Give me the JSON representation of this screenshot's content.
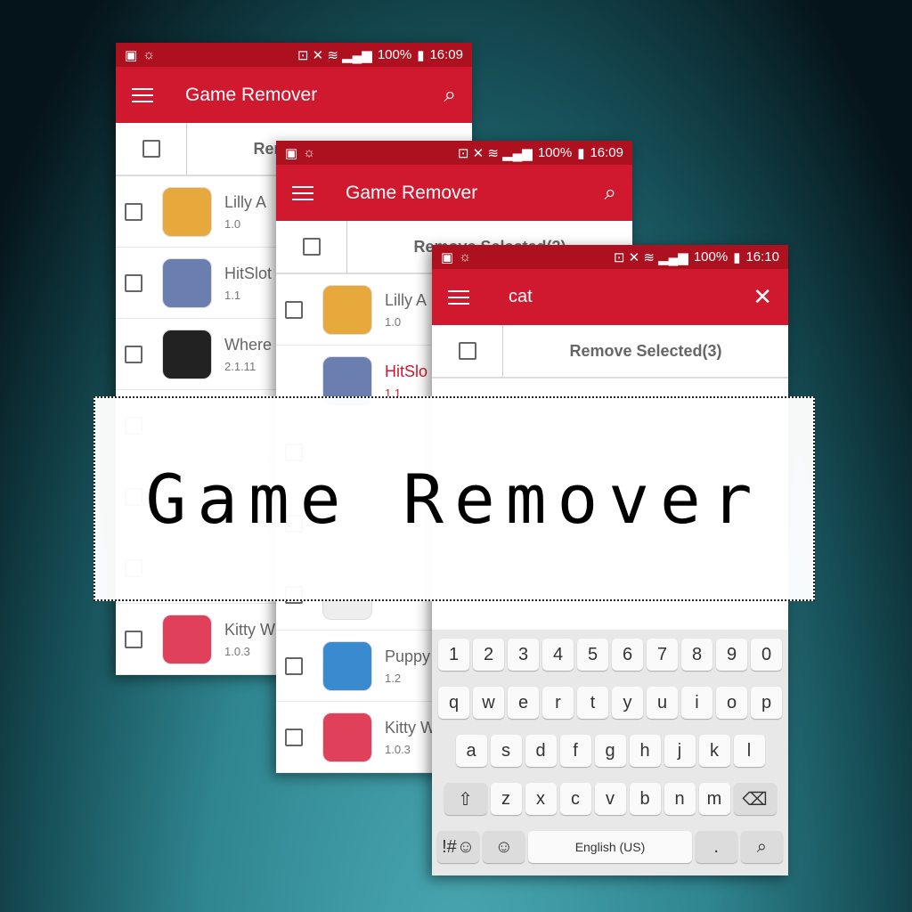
{
  "app_title": "Game Remover",
  "remove_selected": "Remove Selected(3)",
  "banner_text": "Game Remover",
  "phones": [
    {
      "status": {
        "battery": "100%",
        "time": "16:09"
      },
      "rows": [
        {
          "name": "Lilly A",
          "version": "1.0",
          "color": "#e8a93c"
        },
        {
          "name": "HitSlot",
          "version": "1.1",
          "color": "#6a7fb0"
        },
        {
          "name": "Where",
          "version": "2.1.11",
          "color": "#222222"
        },
        {
          "name": "",
          "version": "",
          "color": "#eeeeee"
        },
        {
          "name": "",
          "version": "",
          "color": "#eeeeee"
        },
        {
          "name": "",
          "version": "",
          "color": "#eeeeee"
        },
        {
          "name": "Kitty W",
          "version": "1.0.3",
          "color": "#e0405a"
        }
      ]
    },
    {
      "status": {
        "battery": "100%",
        "time": "16:09"
      },
      "rows": [
        {
          "name": "Lilly A",
          "version": "1.0",
          "color": "#e8a93c"
        },
        {
          "name": "HitSlo",
          "version": "1.1",
          "color": "#6a7fb0",
          "red": true,
          "nocheck": true
        },
        {
          "name": "",
          "version": "",
          "color": "#eeeeee"
        },
        {
          "name": "",
          "version": "",
          "color": "#eeeeee"
        },
        {
          "name": "",
          "version": "",
          "color": "#eeeeee"
        },
        {
          "name": "Puppy",
          "version": "1.2",
          "color": "#3a8ad0"
        },
        {
          "name": "Kitty W",
          "version": "1.0.3",
          "color": "#e0405a"
        }
      ]
    },
    {
      "status": {
        "battery": "100%",
        "time": "16:10"
      },
      "search_value": "cat"
    }
  ],
  "keyboard": {
    "rows": [
      [
        "1",
        "2",
        "3",
        "4",
        "5",
        "6",
        "7",
        "8",
        "9",
        "0"
      ],
      [
        "q",
        "w",
        "e",
        "r",
        "t",
        "y",
        "u",
        "i",
        "o",
        "p"
      ],
      [
        "a",
        "s",
        "d",
        "f",
        "g",
        "h",
        "j",
        "k",
        "l"
      ],
      [
        "⇧",
        "z",
        "x",
        "c",
        "v",
        "b",
        "n",
        "m",
        "⌫"
      ],
      [
        "!#☺",
        "☺",
        "English (US)",
        ".",
        "⌕"
      ]
    ]
  },
  "colors": {
    "primary": "#d0192f",
    "status_bar": "#ad1120"
  }
}
